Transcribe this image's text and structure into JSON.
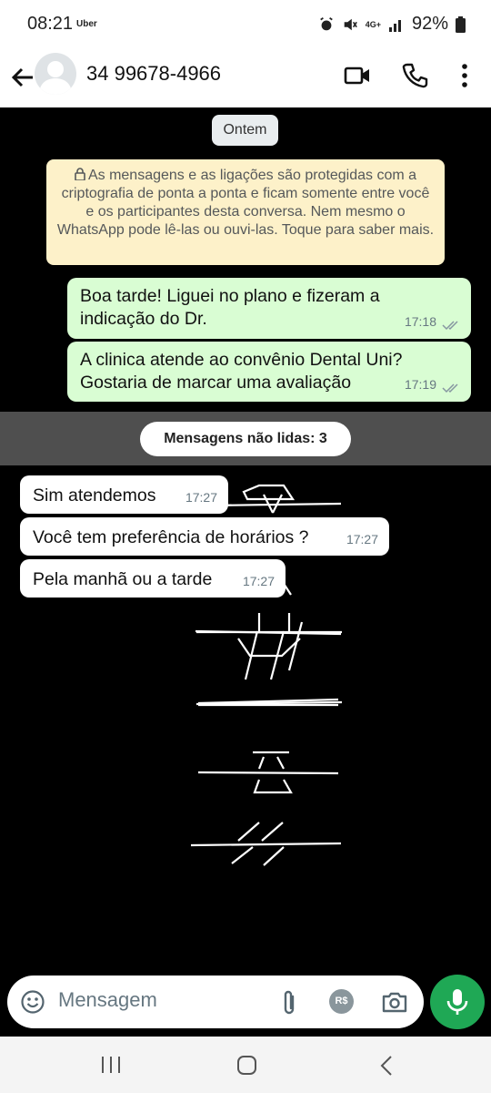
{
  "status_bar": {
    "time": "08:21",
    "notification": "Uber",
    "network": "4G+",
    "battery": "92%"
  },
  "header": {
    "contact_name": "34 99678-4966"
  },
  "chat": {
    "date_chip": "Ontem",
    "encryption_notice": "As mensagens e as ligações são protegidas com a criptografia de ponta a ponta e ficam somente entre você e os participantes desta conversa. Nem mesmo o WhatsApp pode lê-las ou ouvi-las. Toque para saber mais.",
    "messages": [
      {
        "direction": "out",
        "lines": [
          "Boa tarde! Liguei no plano e fizeram a",
          "indicação do Dr."
        ],
        "time": "17:18"
      },
      {
        "direction": "out",
        "lines": [
          "A clinica atende ao convênio Dental Uni?",
          "Gostaria de marcar uma avaliação"
        ],
        "time": "17:19"
      },
      {
        "direction": "in",
        "text": "Sim atendemos",
        "time": "17:27"
      },
      {
        "direction": "in",
        "text": "Você tem preferência de horários ?",
        "time": "17:27"
      },
      {
        "direction": "in",
        "text": "Pela manhã ou a tarde",
        "time": "17:27"
      }
    ],
    "unread_label": "Mensagens não lidas: 3"
  },
  "composer": {
    "placeholder": "Mensagem",
    "currency_icon_label": "R$"
  },
  "colors": {
    "outgoing_bubble": "#d9fdd3",
    "incoming_bubble": "#ffffff",
    "encryption_notice": "#fdf1c9",
    "mic_button": "#1fa855",
    "chat_background": "#000000"
  }
}
